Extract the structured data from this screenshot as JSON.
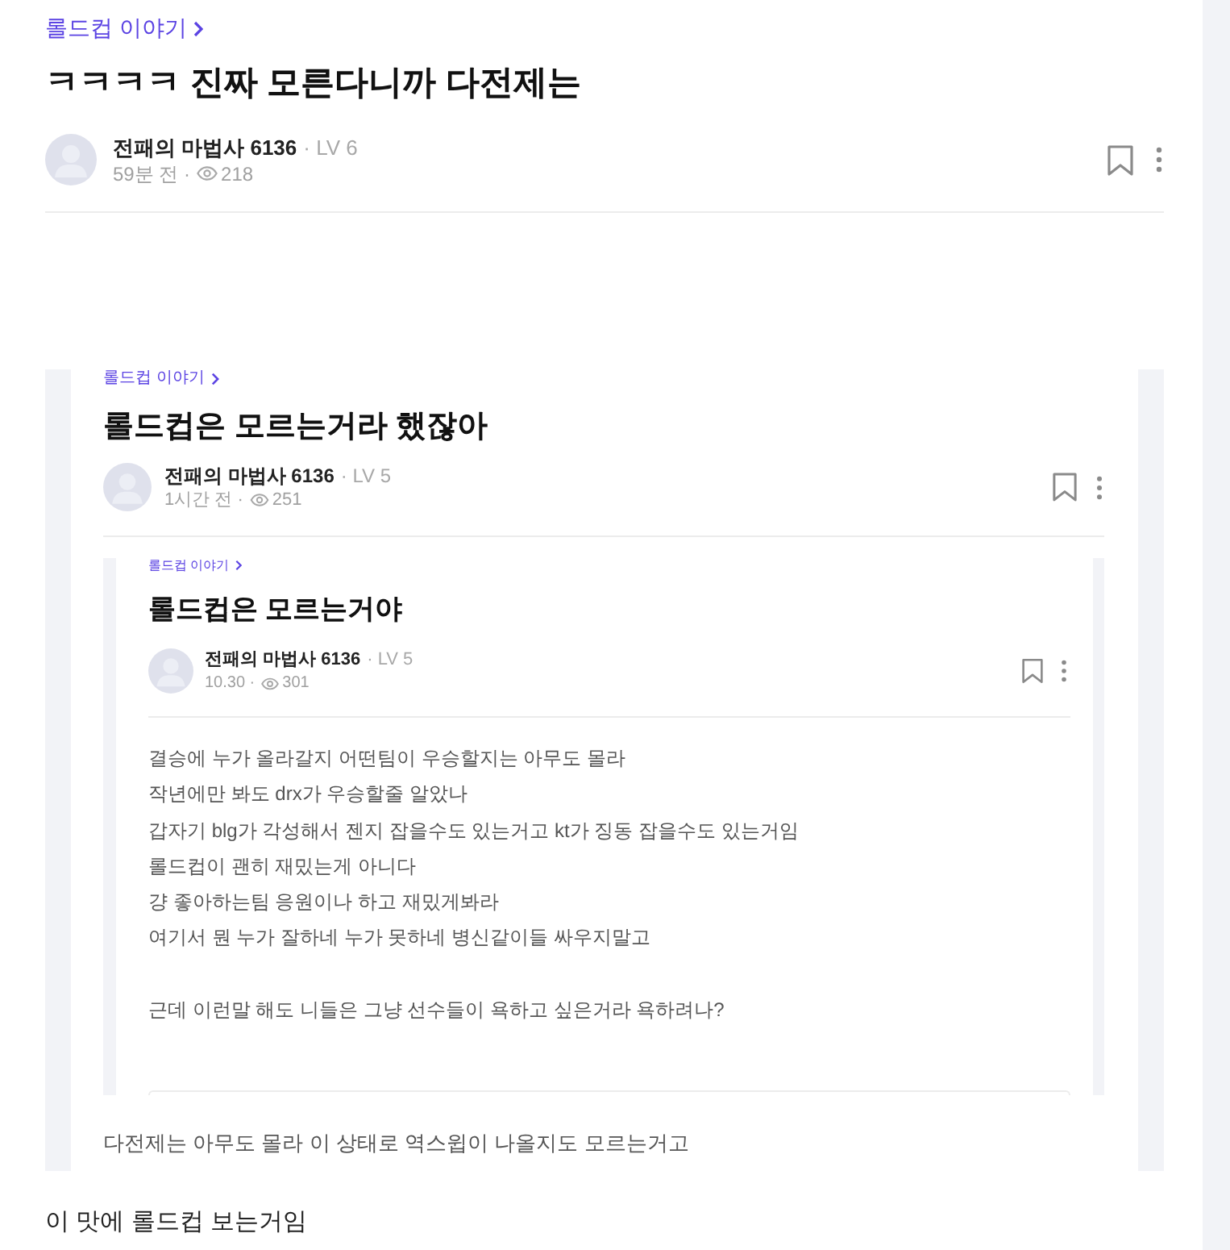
{
  "post": {
    "category": "롤드컵 이야기",
    "title": "ㅋㅋㅋㅋ 진짜 모른다니까 다전제는",
    "author": "전패의 마법사 6136",
    "level": "· LV 6",
    "time": "59분 전 ·",
    "views": "218",
    "content": [
      {
        "kind": "screenshot",
        "post": {
          "category": "롤드컵 이야기",
          "title": "롤드컵은 모르는거라 했잖아",
          "author": "전패의 마법사 6136",
          "level": "· LV 5",
          "time": "1시간 전 ·",
          "views": "251",
          "content": [
            {
              "kind": "screenshot",
              "post": {
                "category": "롤드컵 이야기",
                "title": "롤드컵은 모르는거야",
                "author": "전패의 마법사 6136",
                "level": "· LV 5",
                "time": "10.30 ·",
                "views": "301",
                "content": [
                  {
                    "kind": "text",
                    "lines": [
                      "결승에 누가 올라갈지 어떤팀이 우승할지는 아무도 몰라",
                      "작년에만 봐도 drx가 우승할줄 알았나",
                      "갑자기 blg가 각성해서 젠지 잡을수도 있는거고 kt가 징동 잡을수도 있는거임",
                      "롤드컵이 괜히 재밌는게 아니다",
                      "걍 좋아하는팀 응원이나 하고 재밌게봐라",
                      "여기서 뭔 누가 잘하네 누가 못하네 병신같이들 싸우지말고"
                    ]
                  },
                  {
                    "kind": "text",
                    "lines": [
                      "근데 이런말 해도 니들은 그냥 선수들이 욕하고 싶은거라 욕하려나?"
                    ]
                  }
                ]
              }
            },
            {
              "kind": "text",
              "lines": [
                "다전제는 아무도 몰라 이 상태로 역스윕이 나올지도 모르는거고"
              ]
            }
          ]
        }
      },
      {
        "kind": "text",
        "lines": [
          "이 맛에 롤드컵 보는거임"
        ]
      }
    ]
  }
}
